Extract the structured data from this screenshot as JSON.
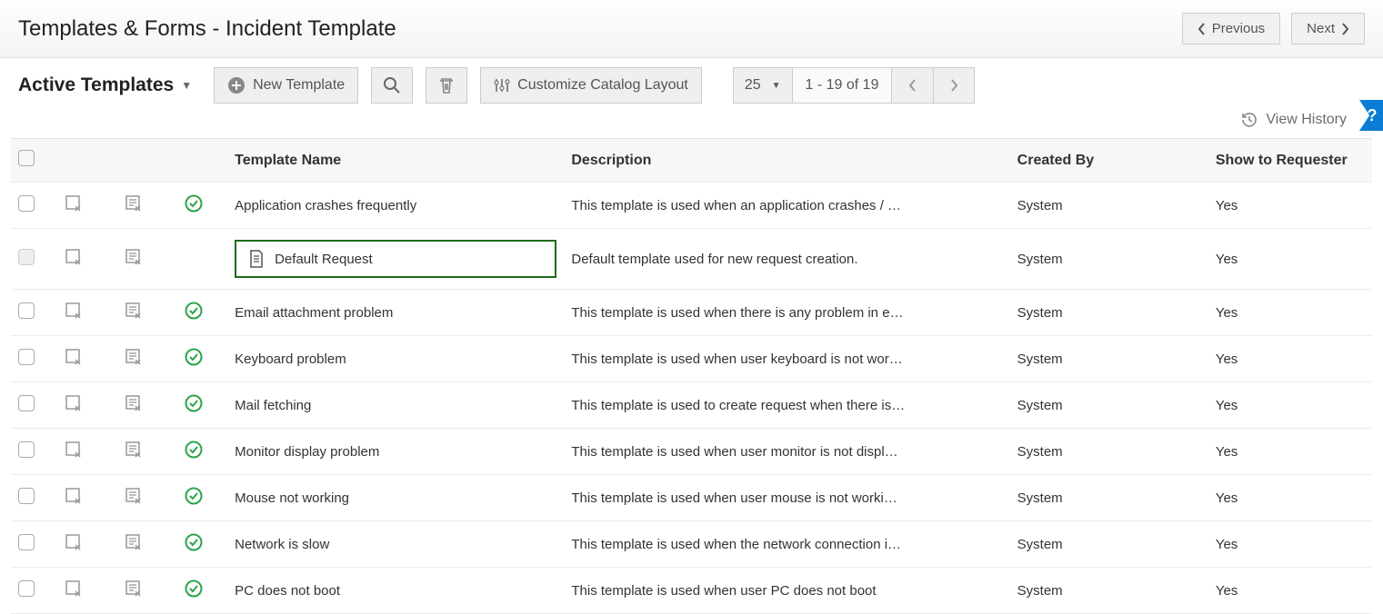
{
  "header": {
    "title": "Templates & Forms - Incident Template",
    "prev": "Previous",
    "next": "Next"
  },
  "toolbar": {
    "scope_label": "Active Templates",
    "new_template": "New Template",
    "customize": "Customize Catalog Layout",
    "page_size": "25",
    "page_range": "1 - 19 of 19",
    "view_history": "View History"
  },
  "columns": {
    "name": "Template Name",
    "desc": "Description",
    "by": "Created By",
    "show": "Show to Requester"
  },
  "rows": [
    {
      "name": "Application crashes frequently",
      "desc": "This template is used when an application crashes / …",
      "by": "System",
      "show": "Yes",
      "status": "ok",
      "highlight": false,
      "note_icon": false
    },
    {
      "name": "Default Request",
      "desc": "Default template used for new request creation.",
      "by": "System",
      "show": "Yes",
      "status": "none",
      "highlight": true,
      "note_icon": true
    },
    {
      "name": "Email attachment problem",
      "desc": "This template is used when there is any problem in e…",
      "by": "System",
      "show": "Yes",
      "status": "ok",
      "highlight": false,
      "note_icon": false
    },
    {
      "name": "Keyboard problem",
      "desc": "This template is used when user keyboard is not wor…",
      "by": "System",
      "show": "Yes",
      "status": "ok",
      "highlight": false,
      "note_icon": false
    },
    {
      "name": "Mail fetching",
      "desc": "This template is used to create request when there is…",
      "by": "System",
      "show": "Yes",
      "status": "ok",
      "highlight": false,
      "note_icon": false
    },
    {
      "name": "Monitor display problem",
      "desc": "This template is used when user monitor is not displ…",
      "by": "System",
      "show": "Yes",
      "status": "ok",
      "highlight": false,
      "note_icon": false
    },
    {
      "name": "Mouse not working",
      "desc": "This template is used when user mouse is not worki…",
      "by": "System",
      "show": "Yes",
      "status": "ok",
      "highlight": false,
      "note_icon": false
    },
    {
      "name": "Network is slow",
      "desc": "This template is used when the network connection i…",
      "by": "System",
      "show": "Yes",
      "status": "ok",
      "highlight": false,
      "note_icon": false
    },
    {
      "name": "PC does not boot",
      "desc": "This template is used when user PC does not boot",
      "by": "System",
      "show": "Yes",
      "status": "ok",
      "highlight": false,
      "note_icon": false
    }
  ]
}
